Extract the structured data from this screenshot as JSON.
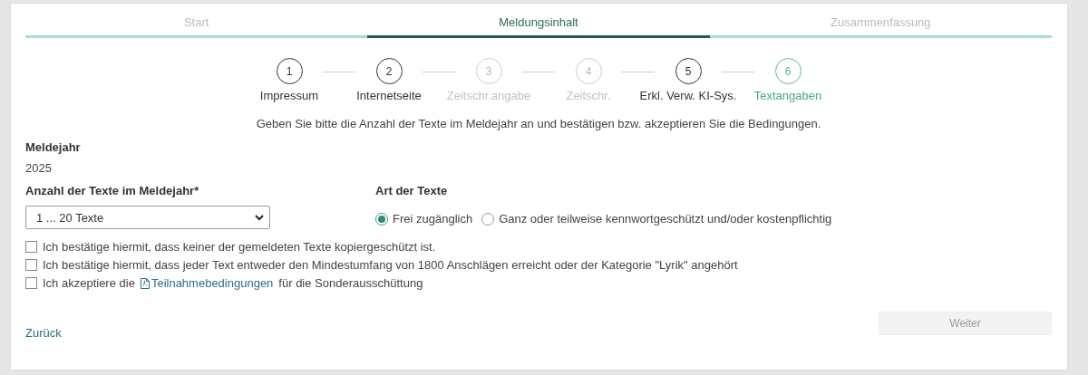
{
  "tabs": [
    {
      "label": "Start",
      "selected": false
    },
    {
      "label": "Meldungsinhalt",
      "selected": true
    },
    {
      "label": "Zusammenfassung",
      "selected": false
    }
  ],
  "steps": [
    {
      "number": "1",
      "label": "Impressum",
      "disabled": false,
      "selected": false
    },
    {
      "number": "2",
      "label": "Internetseite",
      "disabled": false,
      "selected": false
    },
    {
      "number": "3",
      "label": "Zeitschr.angabe",
      "disabled": true,
      "selected": false
    },
    {
      "number": "4",
      "label": "Zeitschr.",
      "disabled": true,
      "selected": false
    },
    {
      "number": "5",
      "label": "Erkl. Verw. KI-Sys.",
      "disabled": false,
      "selected": false
    },
    {
      "number": "6",
      "label": "Textangaben",
      "disabled": false,
      "selected": true
    }
  ],
  "instruction": "Geben Sie bitte die Anzahl der Texte im Meldejahr an und bestätigen bzw. akzeptieren Sie die Bedingungen.",
  "meldejahr": {
    "label": "Meldejahr",
    "value": "2025"
  },
  "anzahl": {
    "label": "Anzahl der Texte im Meldejahr*",
    "value": "1 ... 20 Texte"
  },
  "art": {
    "label": "Art der Texte",
    "options": [
      {
        "label": "Frei zugänglich",
        "selected": true
      },
      {
        "label": "Ganz oder teilweise kennwortgeschützt und/oder kostenpflichtig",
        "selected": false
      }
    ]
  },
  "confirmations": [
    {
      "kind": "plain",
      "text": "Ich bestätige hiermit, dass keiner der gemeldeten Texte kopiergeschützt ist.",
      "checked": false
    },
    {
      "kind": "plain",
      "text": "Ich bestätige hiermit, dass jeder Text entweder den Mindestumfang von 1800 Anschlägen erreicht oder der Kategorie \"Lyrik\" angehört",
      "checked": false
    },
    {
      "kind": "link",
      "before": "Ich akzeptiere die",
      "link": "Teilnahmebedingungen",
      "after": "für die Sonderausschüttung",
      "checked": false
    }
  ],
  "back": "Zurück",
  "next": {
    "label": "Weiter",
    "disabled": true
  }
}
